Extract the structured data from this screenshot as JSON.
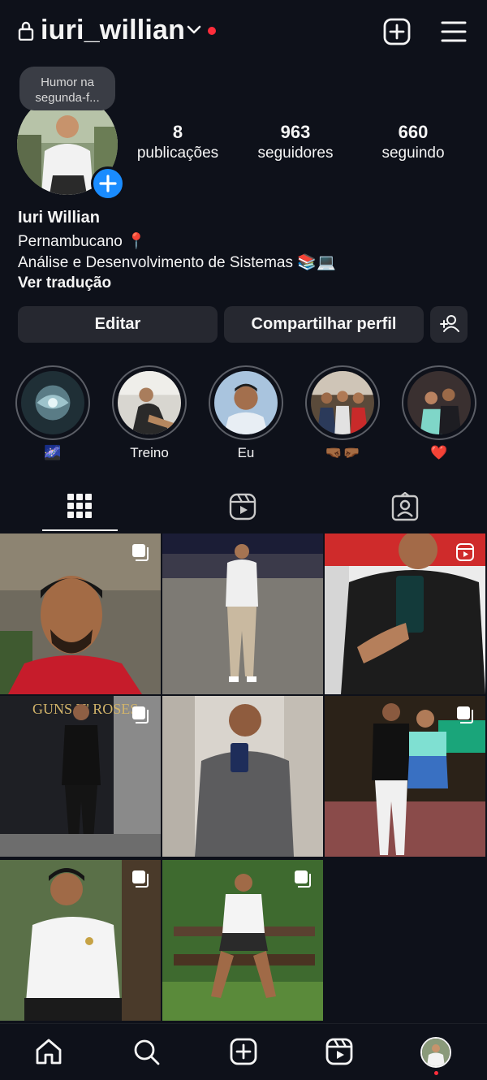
{
  "header": {
    "username": "iuri_willian",
    "icons": [
      "lock-icon",
      "chevron-down-icon",
      "add-post-icon",
      "menu-icon"
    ]
  },
  "note": {
    "line1": "Humor na",
    "line2": "segunda-f..."
  },
  "stats": {
    "posts": {
      "count": "8",
      "label": "publicações"
    },
    "followers": {
      "count": "963",
      "label": "seguidores"
    },
    "following": {
      "count": "660",
      "label": "seguindo"
    }
  },
  "profile": {
    "full_name": "Iuri Willian",
    "bio_line1": "Pernambucano 📍",
    "bio_line2": "Análise e Desenvolvimento de Sistemas 📚💻",
    "translate_label": "Ver tradução"
  },
  "actions": {
    "edit_label": "Editar",
    "share_label": "Compartilhar perfil",
    "discover_icon": "add-person-icon"
  },
  "highlights": [
    {
      "caption": "🌌"
    },
    {
      "caption": "Treino"
    },
    {
      "caption": "Eu"
    },
    {
      "caption": "🤜🏾🤛🏾"
    },
    {
      "caption": "❤️"
    }
  ],
  "tabs": [
    "grid-icon",
    "reels-icon",
    "tagged-icon"
  ],
  "posts": [
    {
      "type": "multi"
    },
    {
      "type": "photo"
    },
    {
      "type": "reel"
    },
    {
      "type": "multi"
    },
    {
      "type": "photo"
    },
    {
      "type": "multi"
    },
    {
      "type": "multi"
    },
    {
      "type": "multi"
    }
  ],
  "bottom_nav": [
    "home-icon",
    "search-icon",
    "create-icon",
    "reels-icon",
    "profile-avatar"
  ],
  "colors": {
    "background": "#0e111a",
    "button": "#262830",
    "accent_blue": "#1a8cff",
    "notification_red": "#ff2d3b"
  }
}
